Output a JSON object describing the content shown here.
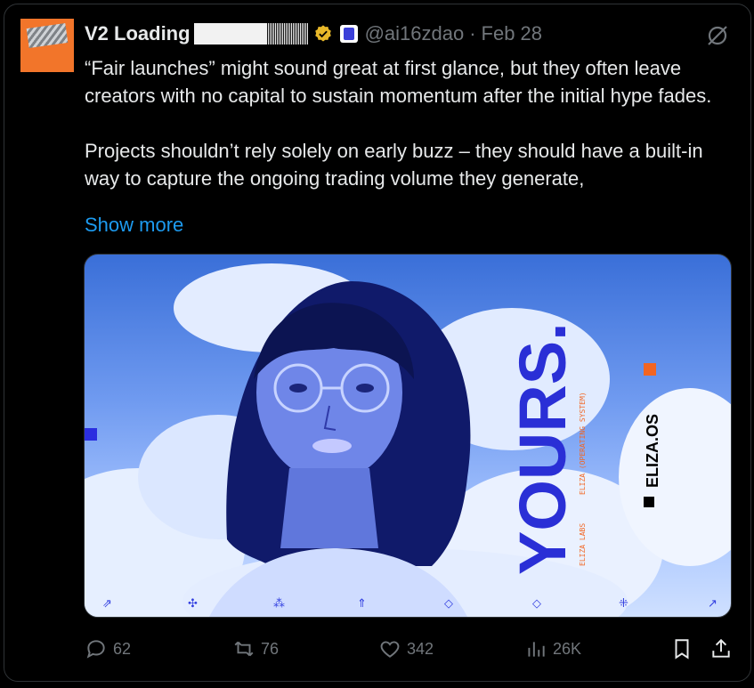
{
  "tweet": {
    "display_name": "V2 Loading",
    "handle": "@ai16zdao",
    "separator": "·",
    "date": "Feb 28",
    "paragraph1": "“Fair launches” might sound great at first glance, but they often leave creators with no capital to sustain momentum after the initial hype fades.",
    "paragraph2": "Projects shouldn’t rely solely on early buzz – they should have a built-in way to capture the ongoing trading volume they generate,",
    "show_more": "Show more"
  },
  "media": {
    "headline": "YOURS.",
    "brand": "ELIZA.OS",
    "side_text": "ELIZA (OPERATING SYSTEM)",
    "side_text_2": "ELIZA LABS"
  },
  "actions": {
    "replies": "62",
    "reposts": "76",
    "likes": "342",
    "views": "26K"
  },
  "colors": {
    "accent": "#1d9bf0",
    "avatar_bg": "#f2752a",
    "verified": "#e8b829",
    "muted": "#71767b"
  }
}
